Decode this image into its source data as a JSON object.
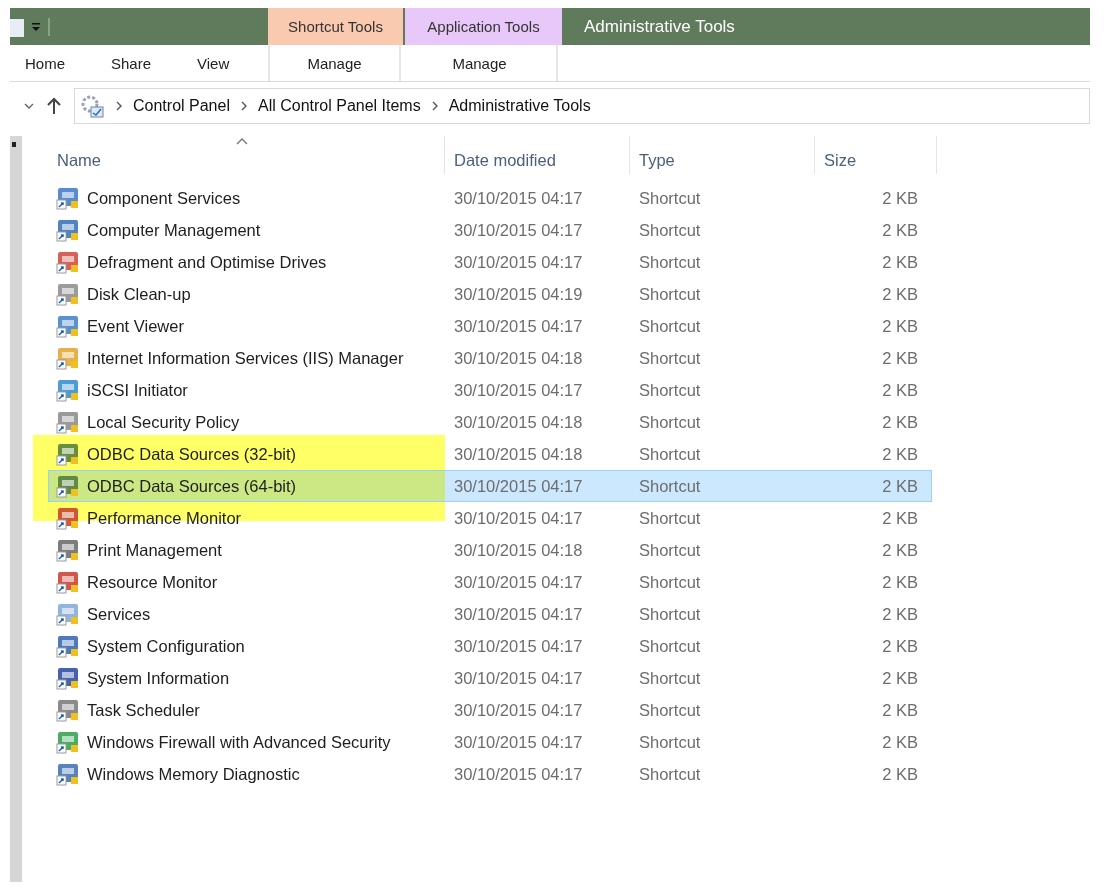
{
  "window": {
    "title": "Administrative Tools"
  },
  "contextual_tabs": [
    {
      "label": "Shortcut Tools",
      "color": "#f9c9b0",
      "tab": "Manage"
    },
    {
      "label": "Application Tools",
      "color": "#e8c8f8",
      "tab": "Manage"
    }
  ],
  "ribbon_tabs": [
    {
      "label": "Home"
    },
    {
      "label": "Share"
    },
    {
      "label": "View"
    }
  ],
  "breadcrumb": [
    "Control Panel",
    "All Control Panel Items",
    "Administrative Tools"
  ],
  "table": {
    "columns": [
      {
        "label": "Name",
        "sorted": true
      },
      {
        "label": "Date modified",
        "sorted": false
      },
      {
        "label": "Type",
        "sorted": false
      },
      {
        "label": "Size",
        "sorted": false
      }
    ],
    "rows": [
      {
        "name": "Component Services",
        "date": "30/10/2015 04:17",
        "type": "Shortcut",
        "size": "2 KB",
        "selected": false,
        "highlighted": false
      },
      {
        "name": "Computer Management",
        "date": "30/10/2015 04:17",
        "type": "Shortcut",
        "size": "2 KB",
        "selected": false,
        "highlighted": false
      },
      {
        "name": "Defragment and Optimise Drives",
        "date": "30/10/2015 04:17",
        "type": "Shortcut",
        "size": "2 KB",
        "selected": false,
        "highlighted": false
      },
      {
        "name": "Disk Clean-up",
        "date": "30/10/2015 04:19",
        "type": "Shortcut",
        "size": "2 KB",
        "selected": false,
        "highlighted": false
      },
      {
        "name": "Event Viewer",
        "date": "30/10/2015 04:17",
        "type": "Shortcut",
        "size": "2 KB",
        "selected": false,
        "highlighted": false
      },
      {
        "name": "Internet Information Services (IIS) Manager",
        "date": "30/10/2015 04:18",
        "type": "Shortcut",
        "size": "2 KB",
        "selected": false,
        "highlighted": false
      },
      {
        "name": "iSCSI Initiator",
        "date": "30/10/2015 04:17",
        "type": "Shortcut",
        "size": "2 KB",
        "selected": false,
        "highlighted": false
      },
      {
        "name": "Local Security Policy",
        "date": "30/10/2015 04:18",
        "type": "Shortcut",
        "size": "2 KB",
        "selected": false,
        "highlighted": false
      },
      {
        "name": "ODBC Data Sources (32-bit)",
        "date": "30/10/2015 04:18",
        "type": "Shortcut",
        "size": "2 KB",
        "selected": false,
        "highlighted": true
      },
      {
        "name": "ODBC Data Sources (64-bit)",
        "date": "30/10/2015 04:17",
        "type": "Shortcut",
        "size": "2 KB",
        "selected": true,
        "highlighted": true
      },
      {
        "name": "Performance Monitor",
        "date": "30/10/2015 04:17",
        "type": "Shortcut",
        "size": "2 KB",
        "selected": false,
        "highlighted": false
      },
      {
        "name": "Print Management",
        "date": "30/10/2015 04:18",
        "type": "Shortcut",
        "size": "2 KB",
        "selected": false,
        "highlighted": false
      },
      {
        "name": "Resource Monitor",
        "date": "30/10/2015 04:17",
        "type": "Shortcut",
        "size": "2 KB",
        "selected": false,
        "highlighted": false
      },
      {
        "name": "Services",
        "date": "30/10/2015 04:17",
        "type": "Shortcut",
        "size": "2 KB",
        "selected": false,
        "highlighted": false
      },
      {
        "name": "System Configuration",
        "date": "30/10/2015 04:17",
        "type": "Shortcut",
        "size": "2 KB",
        "selected": false,
        "highlighted": false
      },
      {
        "name": "System Information",
        "date": "30/10/2015 04:17",
        "type": "Shortcut",
        "size": "2 KB",
        "selected": false,
        "highlighted": false
      },
      {
        "name": "Task Scheduler",
        "date": "30/10/2015 04:17",
        "type": "Shortcut",
        "size": "2 KB",
        "selected": false,
        "highlighted": false
      },
      {
        "name": "Windows Firewall with Advanced Security",
        "date": "30/10/2015 04:17",
        "type": "Shortcut",
        "size": "2 KB",
        "selected": false,
        "highlighted": false
      },
      {
        "name": "Windows Memory Diagnostic",
        "date": "30/10/2015 04:17",
        "type": "Shortcut",
        "size": "2 KB",
        "selected": false,
        "highlighted": false
      }
    ]
  }
}
